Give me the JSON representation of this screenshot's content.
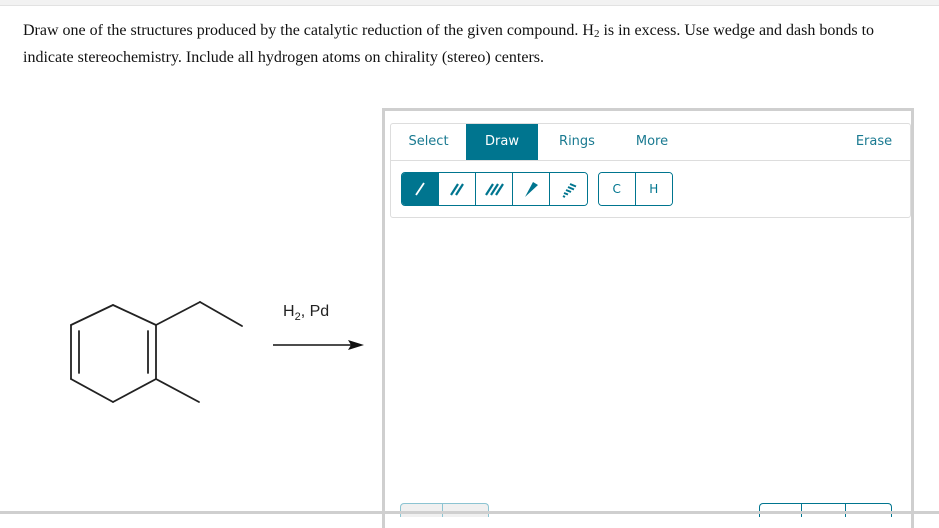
{
  "question": {
    "part1": "Draw one of the structures produced by the catalytic reduction of the given compound. H",
    "subscript": "2",
    "part2": " is in excess. Use wedge and dash bonds to indicate stereochemistry. Include all hydrogen atoms on chirality (stereo) centers."
  },
  "reaction": {
    "reagent_main": "H",
    "reagent_sub": "2",
    "reagent_rest": ", Pd",
    "starting_material": "1-ethyl-2-methyl-1,4-cyclohexadiene"
  },
  "editor": {
    "tabs": [
      {
        "label": "Select",
        "active": false
      },
      {
        "label": "Draw",
        "active": true
      },
      {
        "label": "Rings",
        "active": false
      },
      {
        "label": "More",
        "active": false
      },
      {
        "label": "Erase",
        "active": false
      }
    ],
    "bond_tools": [
      {
        "icon": "single-bond-icon",
        "active": true
      },
      {
        "icon": "double-bond-icon",
        "active": false
      },
      {
        "icon": "triple-bond-icon",
        "active": false
      },
      {
        "icon": "wedge-bond-icon",
        "active": false
      },
      {
        "icon": "dash-bond-icon",
        "active": false
      }
    ],
    "atom_tools": [
      {
        "label": "C"
      },
      {
        "label": "H"
      }
    ]
  },
  "colors": {
    "accent": "#00758f",
    "tab_text": "#1a7a91",
    "border": "#cfcfcf"
  }
}
